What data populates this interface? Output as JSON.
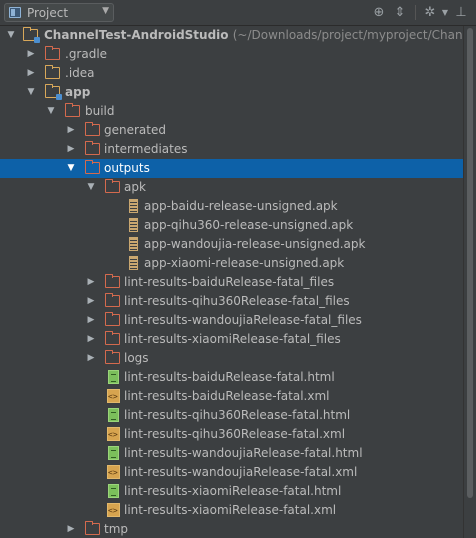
{
  "toolbar": {
    "project_label": "Project",
    "icons": [
      "project-pane-icon",
      "dropdown-arrow-icon",
      "scroll-from-source-icon",
      "collapse-all-icon",
      "settings-gear-icon",
      "hide-panel-icon"
    ]
  },
  "tree": {
    "root": {
      "name": "ChannelTest-AndroidStudio",
      "path": "(~/Downloads/project/myproject/Channe"
    },
    "rows": [
      {
        "label": "ChannelTest-AndroidStudio",
        "icon": "module-root-folder",
        "expanded": true
      },
      {
        "label": ".gradle",
        "icon": "folder-excluded",
        "expanded": false
      },
      {
        "label": ".idea",
        "icon": "folder",
        "expanded": false
      },
      {
        "label": "app",
        "icon": "module-folder",
        "expanded": true
      },
      {
        "label": "build",
        "icon": "folder-excluded",
        "expanded": true
      },
      {
        "label": "generated",
        "icon": "folder-excluded",
        "expanded": false
      },
      {
        "label": "intermediates",
        "icon": "folder-excluded",
        "expanded": false
      },
      {
        "label": "outputs",
        "icon": "folder-excluded",
        "expanded": true,
        "selected": true
      },
      {
        "label": "apk",
        "icon": "folder-excluded",
        "expanded": true
      },
      {
        "label": "app-baidu-release-unsigned.apk",
        "icon": "apk-file"
      },
      {
        "label": "app-qihu360-release-unsigned.apk",
        "icon": "apk-file"
      },
      {
        "label": "app-wandoujia-release-unsigned.apk",
        "icon": "apk-file"
      },
      {
        "label": "app-xiaomi-release-unsigned.apk",
        "icon": "apk-file"
      },
      {
        "label": "lint-results-baiduRelease-fatal_files",
        "icon": "folder-excluded",
        "expanded": false
      },
      {
        "label": "lint-results-qihu360Release-fatal_files",
        "icon": "folder-excluded",
        "expanded": false
      },
      {
        "label": "lint-results-wandoujiaRelease-fatal_files",
        "icon": "folder-excluded",
        "expanded": false
      },
      {
        "label": "lint-results-xiaomiRelease-fatal_files",
        "icon": "folder-excluded",
        "expanded": false
      },
      {
        "label": "logs",
        "icon": "folder-excluded",
        "expanded": false
      },
      {
        "label": "lint-results-baiduRelease-fatal.html",
        "icon": "html-file"
      },
      {
        "label": "lint-results-baiduRelease-fatal.xml",
        "icon": "xml-file"
      },
      {
        "label": "lint-results-qihu360Release-fatal.html",
        "icon": "html-file"
      },
      {
        "label": "lint-results-qihu360Release-fatal.xml",
        "icon": "xml-file"
      },
      {
        "label": "lint-results-wandoujiaRelease-fatal.html",
        "icon": "html-file"
      },
      {
        "label": "lint-results-wandoujiaRelease-fatal.xml",
        "icon": "xml-file"
      },
      {
        "label": "lint-results-xiaomiRelease-fatal.html",
        "icon": "html-file"
      },
      {
        "label": "lint-results-xiaomiRelease-fatal.xml",
        "icon": "xml-file"
      },
      {
        "label": "tmp",
        "icon": "folder-excluded",
        "expanded": false
      }
    ]
  },
  "colors": {
    "background": "#3c3f41",
    "selection": "#0d61a8",
    "text": "#bbbbbb",
    "excluded_folder": "#d46a4e",
    "folder": "#d8a85a"
  }
}
